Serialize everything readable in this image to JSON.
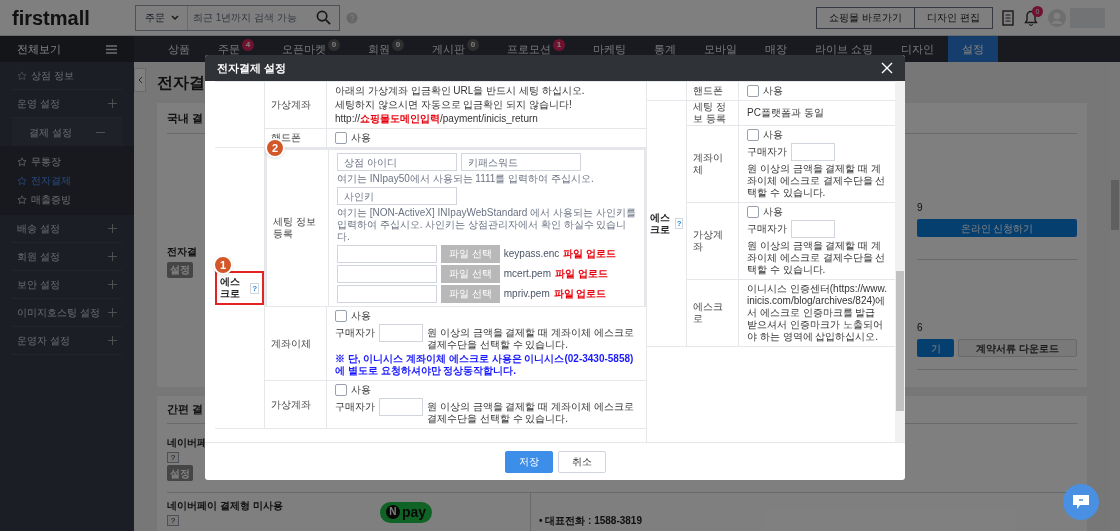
{
  "header": {
    "logo": "firstmall",
    "search": {
      "scope": "주문",
      "placeholder": "최근 1년까지 검색 가능"
    },
    "buttons": [
      "쇼핑몰 바로가기",
      "디자인 편집"
    ],
    "notification_count": "0"
  },
  "nav": {
    "menu_label": "전체보기",
    "tabs": [
      {
        "label": "상품",
        "selected": false
      },
      {
        "label": "주문",
        "badge": {
          "text": "4",
          "highlighted": true
        },
        "selected": false
      },
      {
        "label": "오픈마켓",
        "badge": {
          "text": "0",
          "highlighted": false
        },
        "selected": false
      },
      {
        "label": "회원",
        "badge": {
          "text": "0",
          "highlighted": false
        },
        "selected": false
      },
      {
        "label": "게시판",
        "badge": {
          "text": "0",
          "highlighted": false
        },
        "selected": false
      },
      {
        "label": "프로모션",
        "badge": {
          "text": "1",
          "highlighted": true
        },
        "selected": false
      },
      {
        "label": "마케팅",
        "selected": false
      },
      {
        "label": "통계",
        "selected": false
      },
      {
        "label": "모바일",
        "selected": false
      },
      {
        "label": "매장",
        "selected": false
      },
      {
        "label": "라이브 쇼핑",
        "selected": false
      },
      {
        "label": "디자인",
        "selected": false
      },
      {
        "label": "설정",
        "selected": true
      }
    ]
  },
  "sidebar": {
    "items": [
      {
        "kind": "link",
        "label": "상점 정보"
      },
      {
        "kind": "group",
        "label": "운영 설정",
        "expanded": false
      },
      {
        "kind": "group",
        "label": "결제 설정",
        "expanded": true,
        "children": [
          {
            "label": "무통장",
            "selected": false
          },
          {
            "label": "전자결제",
            "selected": true
          },
          {
            "label": "매출증빙",
            "selected": false
          }
        ]
      },
      {
        "kind": "group",
        "label": "배송 설정",
        "expanded": false
      },
      {
        "kind": "group",
        "label": "회원 설정",
        "expanded": false
      },
      {
        "kind": "group",
        "label": "보안 설정",
        "expanded": false
      },
      {
        "kind": "group",
        "label": "이미지호스팅 설정",
        "expanded": false
      },
      {
        "kind": "group",
        "label": "운영자 설정",
        "expanded": false
      }
    ]
  },
  "page": {
    "title": "전자결",
    "domestic": {
      "heading": "국내 결",
      "pg_label": "전자결",
      "setting_button": "설정",
      "right": {
        "text_1": "9",
        "apply_button": "온라인 신청하기",
        "text_2": "6",
        "button_fragment": "기",
        "download_button": "계약서류 다운로드"
      }
    },
    "easy": {
      "heading": "간편 결",
      "naverpay": {
        "label": "네이버페",
        "help": "?",
        "setting_button": "설정"
      },
      "naverpay_order": {
        "label": "네이버페이 결제형 미사용",
        "help": "?",
        "logo_mark": "N",
        "logo_text": "pay",
        "contact": "• 대표전화 : 1588-3819"
      }
    }
  },
  "modal": {
    "title": "전자결제 설정",
    "pc": {
      "groups": [
        {
          "rows": [
            {
              "kind": "notice",
              "label": "가상계좌",
              "lines": [
                "아래의 가상계좌 입금확인 URL을 반드시 세팅 하십시오.",
                "세팅하지 않으시면 자동으로 입금확인 되지 않습니다!",
                "http://**쇼핑몰도메인입력**/payment/inicis_return"
              ]
            },
            {
              "kind": "checkbox",
              "label": "핸드폰",
              "option": "사용",
              "checked": false
            }
          ]
        },
        {
          "label": "에스크로",
          "help": "?",
          "callout": "1",
          "rows": [
            {
              "kind": "settings",
              "label": "세팅 정보 등록",
              "callout": "2",
              "fields": [
                {
                  "placeholder": "상점 아이디"
                },
                {
                  "placeholder": "키패스워드"
                }
              ],
              "note_1": "여기는 INIpay50에서 사용되는 1111를 입력하여 주십시오.",
              "sign_key": {
                "placeholder": "사인키"
              },
              "note_2": "여기는 [NON-ActiveX] INIpayWebStandard 에서 사용되는 사인키를 입력하여 주십시오. 사인키는 상점관리자에서 확인 하실수 있습니다.",
              "files": [
                {
                  "button": "파일 선택",
                  "filename": "keypass.enc",
                  "upload": "파일 업로드"
                },
                {
                  "button": "파일 선택",
                  "filename": "mcert.pem",
                  "upload": "파일 업로드"
                },
                {
                  "button": "파일 선택",
                  "filename": "mpriv.pem",
                  "upload": "파일 업로드"
                }
              ]
            },
            {
              "kind": "threshold",
              "label": "계좌이체",
              "option": "사용",
              "checked": false,
              "before": "구매자가",
              "after": "원 이상의 금액을 결제할 때 계좌이체 에스크로 결제수단을 선택할 수 있습니다.",
              "note": "※ 단, 이니시스 계좌이체 에스크로 사용은 이니시스(02-3430-5858)에 별도로 요청하셔야만 정상동작합니다."
            },
            {
              "kind": "threshold",
              "label": "가상계좌",
              "option": "사용",
              "checked": false,
              "before": "구매자가",
              "after": "원 이상의 금액을 결제할 때 계좌이체 에스크로 결제수단을 선택할 수 있습니다."
            }
          ]
        }
      ]
    },
    "mobile": {
      "groups": [
        {
          "rows": [
            {
              "kind": "checkbox",
              "label": "핸드폰",
              "option": "사용",
              "checked": false
            }
          ]
        },
        {
          "label": "에스크로",
          "help": "?",
          "rows": [
            {
              "kind": "text",
              "label": "세팅 정보 등록",
              "text": "PC플랫폼과 동일"
            },
            {
              "kind": "threshold",
              "label": "계좌이체",
              "option": "사용",
              "checked": false,
              "before": "구매자가",
              "after": "원 이상의 금액을 결제할 때 계좌이체 에스크로 결제수단을 선택할 수 있습니다."
            },
            {
              "kind": "threshold",
              "label": "가상계좌",
              "option": "사용",
              "checked": false,
              "before": "구매자가",
              "after": "원 이상의 금액을 결제할 때 계좌이체 에스크로 결제수단을 선택할 수 있습니다."
            },
            {
              "kind": "text",
              "label": "에스크로",
              "text": "이니시스 인증센터(https://www.inicis.com/blog/archives/824)에서 에스크로 인증마크를 발급 받으셔서 인증마크가 노출되어야 하는 영역에 삽입하십시오."
            }
          ]
        }
      ]
    },
    "buttons": [
      {
        "kind": "primary",
        "label": "저장"
      },
      {
        "kind": "secondary",
        "label": "취소"
      }
    ]
  }
}
